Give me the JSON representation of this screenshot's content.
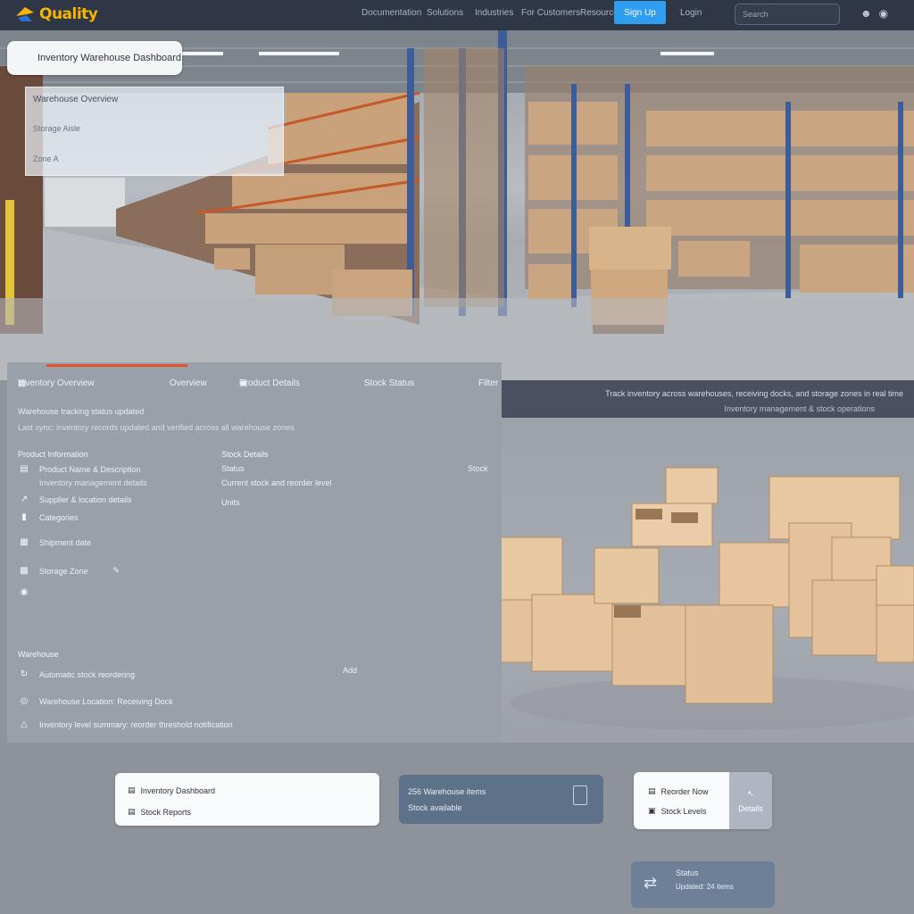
{
  "nav": {
    "logo_text": "Quality",
    "links": [
      "Documentation",
      "Solutions",
      "Industries",
      "For Customers",
      "Resources"
    ],
    "cta": "Sign Up",
    "search_placeholder": "Search",
    "icons": [
      "user-icon",
      "globe-icon"
    ]
  },
  "hero": {
    "pill_text": "Inventory Warehouse Dashboard",
    "card": {
      "title": "Warehouse Overview",
      "subtitle": "Storage Aisle",
      "footer": "Zone A"
    }
  },
  "info": {
    "tabs": [
      "Inventory Overview",
      "Overview",
      "Product Details",
      "Stock Status",
      "Filter"
    ],
    "meta_primary": "Warehouse tracking status updated",
    "meta_secondary": "Last sync: inventory records updated and verified across all warehouse zones",
    "sections": {
      "left_title": "Product Information",
      "right_title": "Stock Details",
      "left_rows": [
        "Product Name & Description",
        "Inventory management details",
        "Supplier & location details",
        "Categories",
        "Shipment date",
        "Storage Zone"
      ],
      "right_rows": [
        "Status",
        "Current stock and reorder level",
        "Units"
      ],
      "right_badge": "Stock",
      "bottom_title": "Warehouse",
      "bottom_rows": [
        "Automatic stock reordering",
        "Warehouse Location: Receiving Dock",
        "Inventory level summary: reorder threshold notification"
      ],
      "bottom_badge": "Add"
    }
  },
  "strip": {
    "line1": "Track inventory across warehouses, receiving docks, and storage zones in real time",
    "line2": "Inventory management & stock operations"
  },
  "bottom": {
    "card1": [
      "Inventory Dashboard",
      "Stock Reports"
    ],
    "card2": [
      "256 Warehouse items",
      "Stock available"
    ],
    "card3": [
      "Reorder Now",
      "Stock Levels"
    ],
    "card3_side": "Details",
    "card4": [
      "Status",
      "Updated: 24 items"
    ]
  },
  "colors": {
    "accent_blue": "#2f9df0",
    "accent_orange": "#e2552c",
    "logo_gold": "#f4b400",
    "topbar": "#2f3646"
  }
}
